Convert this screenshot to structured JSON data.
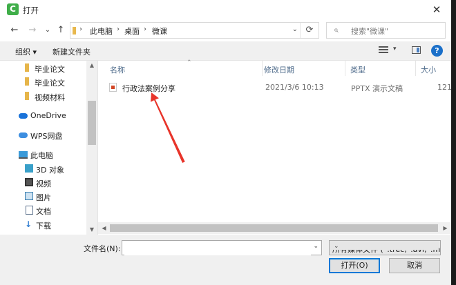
{
  "window": {
    "title": "打开",
    "app_icon_letter": "C",
    "close_glyph": "✕"
  },
  "nav": {
    "back": "←",
    "forward": "→",
    "history": "⌄",
    "up": "↑",
    "breadcrumb": [
      "此电脑",
      "桌面",
      "微课"
    ],
    "separator": "›",
    "refresh": "⟳",
    "search_placeholder": "搜索\"微课\""
  },
  "toolbar": {
    "organize": "组织 ▾",
    "new_folder": "新建文件夹",
    "help": "?"
  },
  "sidebar": {
    "items": [
      {
        "label": "毕业论文",
        "icon": "folder-icon"
      },
      {
        "label": "毕业论文",
        "icon": "folder-icon"
      },
      {
        "label": "视频材料",
        "icon": "folder-icon"
      },
      {
        "label": "OneDrive",
        "icon": "onedrive-icon"
      },
      {
        "label": "WPS网盘",
        "icon": "wps-cloud-icon"
      },
      {
        "label": "此电脑",
        "icon": "computer-icon"
      },
      {
        "label": "3D 对象",
        "icon": "3d-objects-icon"
      },
      {
        "label": "视频",
        "icon": "videos-icon"
      },
      {
        "label": "图片",
        "icon": "pictures-icon"
      },
      {
        "label": "文档",
        "icon": "documents-icon"
      },
      {
        "label": "下载",
        "icon": "downloads-icon"
      }
    ]
  },
  "columns": [
    "名称",
    "修改日期",
    "类型",
    "大小"
  ],
  "files": [
    {
      "name": "行政法案例分享",
      "modified": "2021/3/6 10:13",
      "type": "PPTX 演示文稿",
      "size": "121"
    }
  ],
  "footer": {
    "filename_label": "文件名(N):",
    "filename_value": "",
    "filetype": "所有媒体文件 (*.trec,*.avi,*.mp",
    "open_button": "打开(O)",
    "cancel_button": "取消"
  },
  "colors": {
    "accent": "#0078d7",
    "annotation_arrow": "#e8342a",
    "folder": "#e6b54a"
  }
}
